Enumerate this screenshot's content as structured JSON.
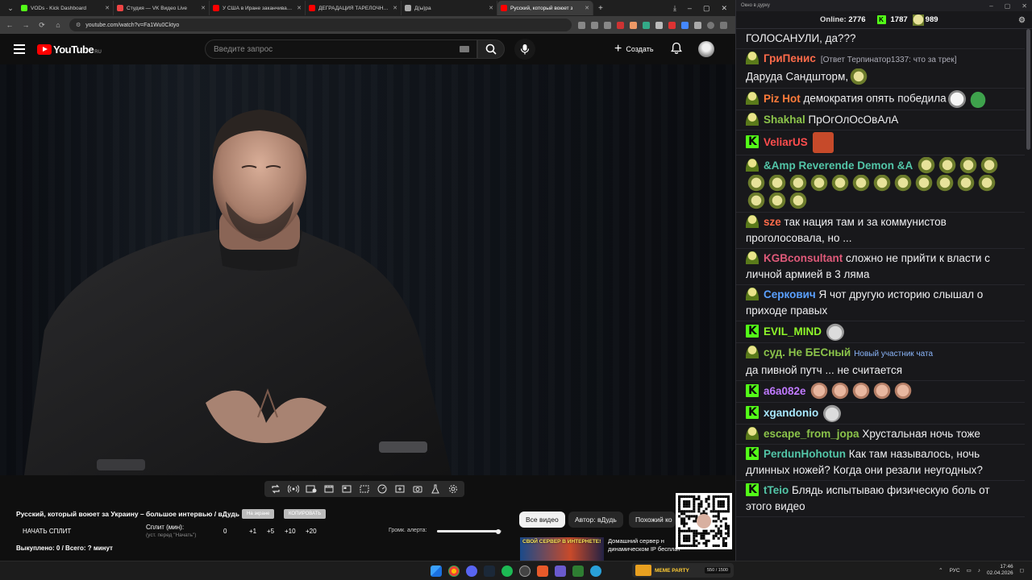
{
  "browser": {
    "tabs": [
      {
        "title": "VODs - Kick Dashboard",
        "color": "#53fc18",
        "active": false
      },
      {
        "title": "Студия — VK Видео Live",
        "color": "#e44",
        "active": false
      },
      {
        "title": "У США в Иране заканчиваютс",
        "color": "#f00",
        "active": false
      },
      {
        "title": "ДЕГРАДАЦИЯ ТАРЕЛОЧНИЦ",
        "color": "#f00",
        "active": false
      },
      {
        "title": "Д(ы)ра",
        "color": "#aaa",
        "active": false
      },
      {
        "title": "Русский, который воюет з",
        "color": "#f00",
        "active": true
      }
    ],
    "url": "youtube.com/watch?v=Fa1Wu0Cktyo"
  },
  "youtube": {
    "logo_text": "YouTube",
    "region": "RU",
    "search_placeholder": "Введите запрос",
    "create_label": "Создать"
  },
  "overlay": {
    "video_title": "Русский, который воюет за Украину – большое интервью / вДудь",
    "btn_on_screen": "На экране",
    "btn_copy": "КОПИРОВАТЬ",
    "start_split": "НАЧАТЬ СПЛИТ",
    "split_label": "Сплит (мин):",
    "split_sub": "(уст. перед \"Начать\")",
    "split_value": "0",
    "inc_1": "+1",
    "inc_5": "+5",
    "inc_10": "+10",
    "inc_20": "+20",
    "bought": "Выкуплено: 0 / Всего: ? минут",
    "volume_label": "Громк. алерта:",
    "volume_level": 0.95
  },
  "chips": {
    "all": "Все видео",
    "author": "Автор: вДудь",
    "similar": "Похожий ко"
  },
  "recommended": {
    "thumb_caption": "СВОЙ СЕРВЕР В ИНТЕРНЕТЕ!",
    "title_line1": "Домашний сервер н",
    "title_line2": "динамическом IP бесплатно!..."
  },
  "chat": {
    "window_title": "Окно в дурку",
    "online_label": "Online:",
    "online_count": "2776",
    "followers": "1787",
    "subs": "989",
    "messages": [
      {
        "badge": "none",
        "user": "",
        "color": "#ffffff",
        "text": "ГОЛОСАНУЛИ, да???",
        "reply": "",
        "newbie": "",
        "emotes": []
      },
      {
        "badge": "sub",
        "user": "ГриПенис",
        "color": "#ff6b4a",
        "text": "Даруда Сандшторм,",
        "reply": "[Ответ Терпинатор1337: что за трек]",
        "newbie": "",
        "emotes": [
          "em-pepe"
        ]
      },
      {
        "badge": "sub",
        "user": "Piz Hot",
        "color": "#ff7b3a",
        "text": "демократия опять победила",
        "reply": "",
        "newbie": "",
        "emotes": [
          "em-troll",
          "em-frog"
        ]
      },
      {
        "badge": "sub",
        "user": "Shakhal",
        "color": "#8bc34a",
        "text": "ПрОгОлОсОвАлА",
        "reply": "",
        "newbie": "",
        "emotes": []
      },
      {
        "badge": "kick",
        "user": "VeliarUS",
        "color": "#ff4d4d",
        "text": "",
        "reply": "",
        "newbie": "",
        "emotes": [
          "em-red"
        ]
      },
      {
        "badge": "sub",
        "user": "&Amp Reverende Demon &A",
        "color": "#53c6a8",
        "text": "",
        "reply": "",
        "newbie": "",
        "emotes": [
          "em-pepe",
          "em-pepe",
          "em-pepe",
          "em-pepe",
          "em-pepe",
          "em-pepe",
          "em-pepe",
          "em-pepe",
          "em-pepe",
          "em-pepe",
          "em-pepe",
          "em-pepe",
          "em-pepe",
          "em-pepe",
          "em-pepe",
          "em-pepe",
          "em-pepe",
          "em-pepe",
          "em-pepe"
        ]
      },
      {
        "badge": "sub",
        "user": "sze",
        "color": "#ff6b4a",
        "text": "так нация там и за коммунистов проголосовала, но ...",
        "reply": "",
        "newbie": "",
        "emotes": []
      },
      {
        "badge": "sub",
        "user": "KGBconsultant",
        "color": "#e05a7a",
        "text": "сложно не прийти к власти с личной армией в 3 ляма",
        "reply": "",
        "newbie": "",
        "emotes": []
      },
      {
        "badge": "sub",
        "user": "Серкович",
        "color": "#5aa0ff",
        "text": "Я чот другую историю слышал о приходе правых",
        "reply": "",
        "newbie": "",
        "emotes": []
      },
      {
        "badge": "kick",
        "user": "EVIL_MIND",
        "color": "#8ef52a",
        "text": "",
        "reply": "",
        "newbie": "",
        "emotes": [
          "em-cat"
        ]
      },
      {
        "badge": "sub",
        "user": "суд. Не БЕСный",
        "color": "#8bc34a",
        "text": "да пивной путч ... не считается",
        "reply": "",
        "newbie": "Новый участник чата",
        "emotes": []
      },
      {
        "badge": "kick",
        "user": "a6a082e",
        "color": "#c07aff",
        "text": "",
        "reply": "",
        "newbie": "",
        "emotes": [
          "em-face",
          "em-face",
          "em-face",
          "em-face",
          "em-face"
        ]
      },
      {
        "badge": "kick",
        "user": "xgandonio",
        "color": "#a8e8ff",
        "text": "",
        "reply": "",
        "newbie": "",
        "emotes": [
          "em-cat"
        ]
      },
      {
        "badge": "sub",
        "user": "escape_from_jopa",
        "color": "#8bc34a",
        "text": "Хрустальная ночь тоже",
        "reply": "",
        "newbie": "",
        "emotes": []
      },
      {
        "badge": "kick",
        "user": "PerdunHohotun",
        "color": "#53c6a8",
        "text": "Как там называлось, ночь длинных ножей? Когда они резали неугодных?",
        "reply": "",
        "newbie": "",
        "emotes": []
      },
      {
        "badge": "kick",
        "user": "tTeio",
        "color": "#53c6a8",
        "text": "Блядь испытываю физическую боль от этого видео",
        "reply": "",
        "newbie": "",
        "emotes": []
      }
    ]
  },
  "taskbar": {
    "promo_title": "MEME PARTY",
    "promo_count": "550 / 1500",
    "lang": "РУС",
    "time": "17:46",
    "date": "02.04.2026"
  }
}
